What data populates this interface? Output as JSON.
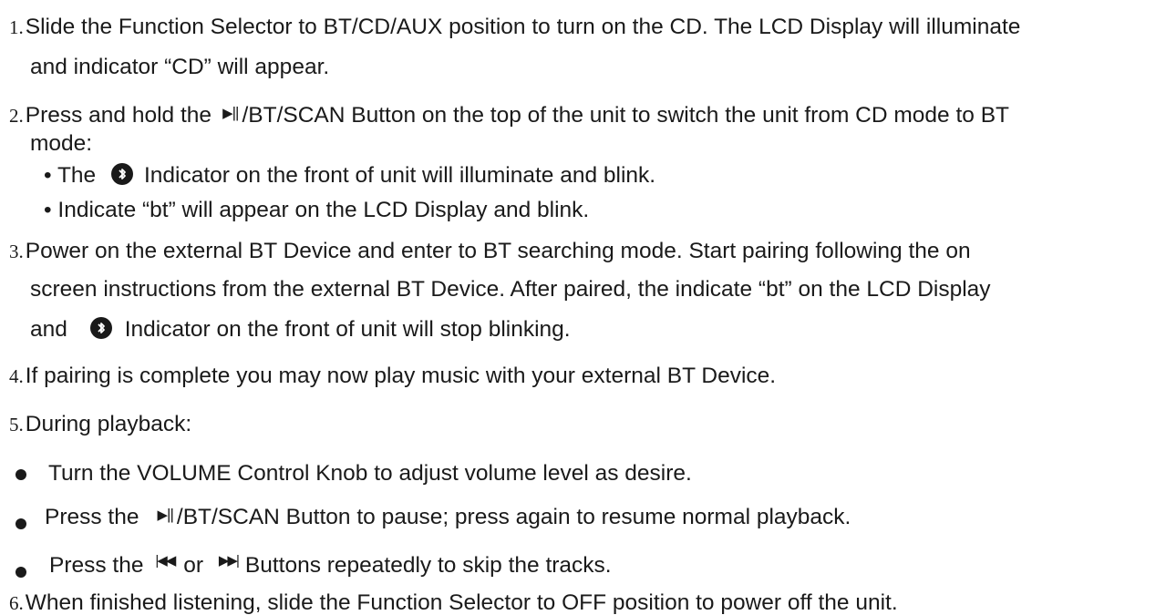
{
  "steps": {
    "s1": {
      "num": "1.",
      "line1": "Slide the Function Selector to BT/CD/AUX position to turn on the CD.  The LCD Display will illuminate",
      "line2": "and indicator “CD” will appear."
    },
    "s2": {
      "num": "2.",
      "pre": "Press and hold the",
      "post": "/BT/SCAN Button on the top of the unit to switch the unit from CD mode to BT",
      "line2": "mode:",
      "sub1_pre": "• The",
      "sub1_post": "Indicator on the front of unit will illuminate and blink.",
      "sub2": "• Indicate “bt” will appear on the LCD Display and blink."
    },
    "s3": {
      "num": "3.",
      "line1": "Power on the external BT Device and enter to BT searching mode. Start pairing following the on",
      "line2": "screen instructions from the external BT Device. After paired, the indicate “bt” on the LCD Display",
      "line3_pre": "and",
      "line3_post": "Indicator on the front of unit will stop blinking."
    },
    "s4": {
      "num": "4.",
      "text": "If pairing is complete you may now play music with your external BT Device."
    },
    "s5": {
      "num": "5.",
      "text": "During playback:"
    },
    "b1": {
      "text": "Turn the VOLUME Control Knob to adjust volume level as desire."
    },
    "b2": {
      "pre": "Press the",
      "post": "/BT/SCAN Button to pause; press again to resume normal playback."
    },
    "b3": {
      "pre": "Press the",
      "mid": "or",
      "post": "Buttons repeatedly to skip the tracks."
    },
    "s6": {
      "num": "6.",
      "text": "When finished listening, slide the Function Selector to OFF position to power off the unit."
    }
  },
  "icons": [
    "play-pause-icon",
    "bluetooth-icon",
    "previous-track-icon",
    "next-track-icon"
  ]
}
